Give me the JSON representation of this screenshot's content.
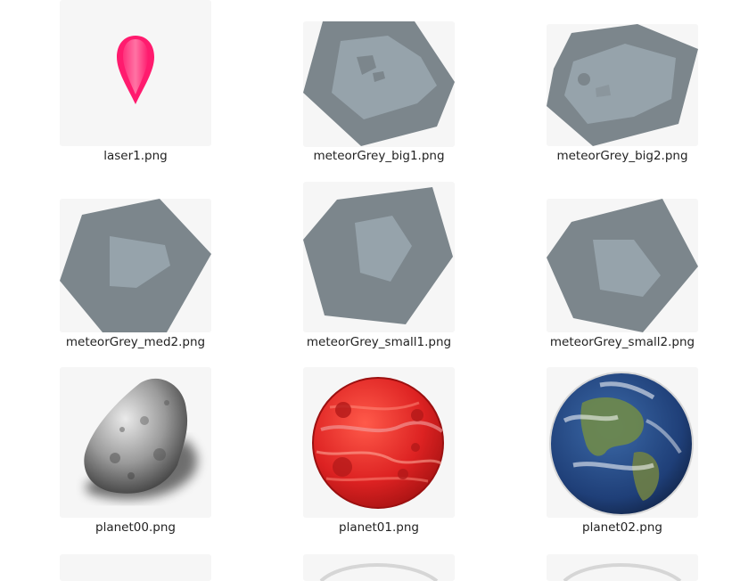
{
  "files": [
    {
      "name": "laser1.png",
      "icon": "laser-icon"
    },
    {
      "name": "meteorGrey_big1.png",
      "icon": "meteor-icon"
    },
    {
      "name": "meteorGrey_big2.png",
      "icon": "meteor-icon"
    },
    {
      "name": "meteorGrey_med2.png",
      "icon": "meteor-icon"
    },
    {
      "name": "meteorGrey_small1.png",
      "icon": "meteor-icon"
    },
    {
      "name": "meteorGrey_small2.png",
      "icon": "meteor-icon"
    },
    {
      "name": "planet00.png",
      "icon": "asteroid-icon"
    },
    {
      "name": "planet01.png",
      "icon": "red-planet-icon"
    },
    {
      "name": "planet02.png",
      "icon": "earth-icon"
    }
  ],
  "colors": {
    "thumb_bg": "#f6f6f6",
    "meteor_dark": "#7c868c",
    "meteor_edge": "#6e787e",
    "meteor_light": "#96a3ab",
    "laser": "#ff2277",
    "red_planet": "#dd2222",
    "earth_ocean": "#1f3f78"
  }
}
